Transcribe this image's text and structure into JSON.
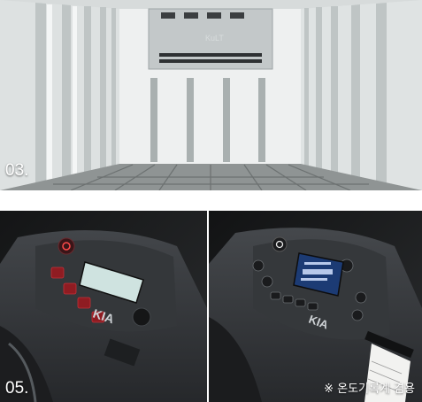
{
  "panels": [
    {
      "id": "top",
      "caption": "03.",
      "subject": "refrigerated-cargo-box-interior"
    },
    {
      "id": "bottom-left",
      "caption": "05.",
      "subject": "temperature-controller-panel",
      "logo_text": "KIA",
      "lcd_lines": [
        "",
        ""
      ]
    },
    {
      "id": "bottom-right",
      "caption": "",
      "note": "※ 온도기록계 겸용",
      "subject": "temperature-controller-with-recorder",
      "logo_text": "KIA"
    }
  ],
  "colors": {
    "cargo_wall": "#e9ecec",
    "floor": "#8c9090",
    "console": "#2b2d30",
    "lcd": "#cfe3e0",
    "red_button": "#b01820"
  }
}
